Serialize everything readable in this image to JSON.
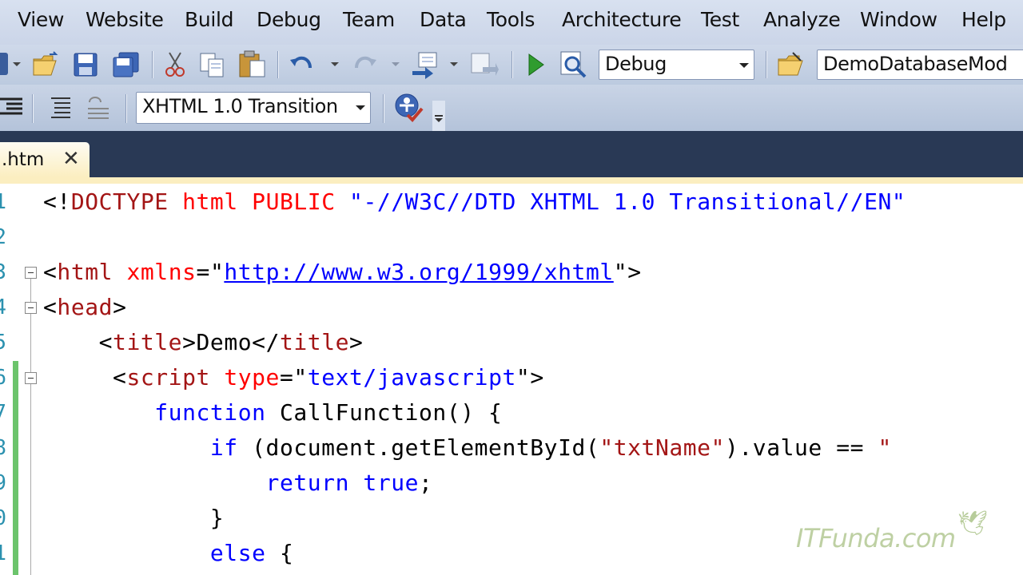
{
  "menu": [
    "View",
    "Website",
    "Build",
    "Debug",
    "Team",
    "Data",
    "Tools",
    "Architecture",
    "Test",
    "Analyze",
    "Window",
    "Help"
  ],
  "toolbar": {
    "solution_config": "Debug",
    "startup_project": "DemoDatabaseMod",
    "doc_validation": "XHTML 1.0 Transition",
    "icons": [
      "add-item-icon",
      "open-folder-icon",
      "save-icon",
      "save-all-icon",
      "cut-icon",
      "copy-icon",
      "paste-icon",
      "undo-icon",
      "redo-icon",
      "navigate-icon",
      "find-icon",
      "start-debug-icon",
      "attach-icon",
      "solution-explorer-icon",
      "indent-icon",
      "format-icon",
      "outdent-icon",
      "check-accessibility-icon"
    ]
  },
  "tab": {
    "name": ".htm",
    "close": "✕"
  },
  "editor": {
    "line_numbers": [
      "1",
      "2",
      "3",
      "4",
      "5",
      "6",
      "7",
      "8",
      "9",
      "0",
      "1"
    ],
    "lines": [
      [
        {
          "c": "p",
          "t": "<!"
        },
        {
          "c": "t",
          "t": "DOCTYPE"
        },
        {
          "c": "p",
          "t": " "
        },
        {
          "c": "a",
          "t": "html"
        },
        {
          "c": "p",
          "t": " "
        },
        {
          "c": "a",
          "t": "PUBLIC"
        },
        {
          "c": "p",
          "t": " "
        },
        {
          "c": "s",
          "t": "\"-//W3C//DTD XHTML 1.0 Transitional//EN\""
        }
      ],
      [],
      [
        {
          "c": "p",
          "t": "<"
        },
        {
          "c": "t",
          "t": "html"
        },
        {
          "c": "p",
          "t": " "
        },
        {
          "c": "a",
          "t": "xmlns"
        },
        {
          "c": "p",
          "t": "=\""
        },
        {
          "c": "u",
          "t": "http://www.w3.org/1999/xhtml"
        },
        {
          "c": "p",
          "t": "\">"
        }
      ],
      [
        {
          "c": "p",
          "t": "<"
        },
        {
          "c": "t",
          "t": "head"
        },
        {
          "c": "p",
          "t": ">"
        }
      ],
      [
        {
          "c": "p",
          "t": "    <"
        },
        {
          "c": "t",
          "t": "title"
        },
        {
          "c": "p",
          "t": ">"
        },
        {
          "c": "bl",
          "t": "Demo"
        },
        {
          "c": "p",
          "t": "</"
        },
        {
          "c": "t",
          "t": "title"
        },
        {
          "c": "p",
          "t": ">"
        }
      ],
      [
        {
          "c": "p",
          "t": "     <"
        },
        {
          "c": "t",
          "t": "script"
        },
        {
          "c": "p",
          "t": " "
        },
        {
          "c": "a",
          "t": "type"
        },
        {
          "c": "p",
          "t": "=\""
        },
        {
          "c": "s",
          "t": "text/javascript"
        },
        {
          "c": "p",
          "t": "\">"
        }
      ],
      [
        {
          "c": "p",
          "t": "        "
        },
        {
          "c": "k",
          "t": "function"
        },
        {
          "c": "bl",
          "t": " CallFunction() {"
        }
      ],
      [
        {
          "c": "p",
          "t": "            "
        },
        {
          "c": "k",
          "t": "if"
        },
        {
          "c": "bl",
          "t": " (document.getElementById("
        },
        {
          "c": "t",
          "t": "\"txtName\""
        },
        {
          "c": "bl",
          "t": ").value == "
        },
        {
          "c": "t",
          "t": "\""
        }
      ],
      [
        {
          "c": "p",
          "t": "                "
        },
        {
          "c": "k",
          "t": "return"
        },
        {
          "c": "p",
          "t": " "
        },
        {
          "c": "k",
          "t": "true"
        },
        {
          "c": "bl",
          "t": ";"
        }
      ],
      [
        {
          "c": "p",
          "t": "            "
        },
        {
          "c": "bl",
          "t": "}"
        }
      ],
      [
        {
          "c": "p",
          "t": "            "
        },
        {
          "c": "k",
          "t": "else"
        },
        {
          "c": "bl",
          "t": " {"
        }
      ]
    ]
  },
  "watermark": "ITFunda.com",
  "colors": {
    "tab_strip": "#293955",
    "active_tab": "#fbeec0",
    "change_marker": "#6cc46c",
    "line_number": "#2b91af"
  }
}
